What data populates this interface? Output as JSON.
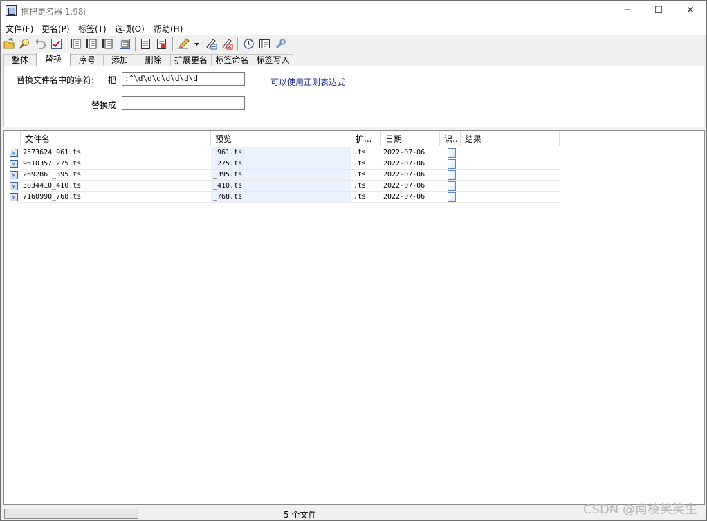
{
  "window": {
    "title": "拖把更名器 1.98i",
    "controls": {
      "minimize": "─",
      "maximize": "☐",
      "close": "✕"
    }
  },
  "menu": [
    "文件(F)",
    "更名(P)",
    "标签(T)",
    "选项(O)",
    "帮助(H)"
  ],
  "toolbar": {
    "icons": [
      "open-folder-icon",
      "search-icon",
      "undo-icon",
      "check-icon",
      "tag-1-icon",
      "tag-2-icon",
      "tag-3-icon",
      "tag-edit-icon",
      "document-icon",
      "document-export-icon",
      "pen-icon",
      "dropdown-arrow-icon",
      "rename-edit-icon",
      "rename-clear-icon",
      "clock-icon",
      "settings-panel-icon",
      "tools-icon"
    ]
  },
  "tabs": [
    "整体",
    "替换",
    "序号",
    "添加",
    "删除",
    "扩展更名",
    "标签命名",
    "标签写入"
  ],
  "active_tab": "替换",
  "replace": {
    "find_label": "替换文件名中的字符:",
    "by_label": "把",
    "find_value": ":^\\d\\d\\d\\d\\d\\d\\d",
    "replace_label": "替换成",
    "replace_value": "",
    "regex_note": "可以使用正则表达式"
  },
  "table": {
    "headers": [
      "文件名",
      "预览",
      "扩...",
      "日期",
      "识..",
      "结果"
    ],
    "rows": [
      {
        "checked": "√",
        "filename": "7573624_961.ts",
        "preview": "_961.ts",
        "ext": ".ts",
        "date": "2022-07-06",
        "result": ""
      },
      {
        "checked": "√",
        "filename": "9610357_275.ts",
        "preview": "_275.ts",
        "ext": ".ts",
        "date": "2022-07-06",
        "result": ""
      },
      {
        "checked": "√",
        "filename": "2692861_395.ts",
        "preview": "_395.ts",
        "ext": ".ts",
        "date": "2022-07-06",
        "result": ""
      },
      {
        "checked": "√",
        "filename": "3034410_410.ts",
        "preview": "_410.ts",
        "ext": ".ts",
        "date": "2022-07-06",
        "result": ""
      },
      {
        "checked": "√",
        "filename": "7160990_768.ts",
        "preview": "_768.ts",
        "ext": ".ts",
        "date": "2022-07-06",
        "result": ""
      }
    ]
  },
  "status": {
    "file_count": "5 个文件",
    "progress": 0
  },
  "watermark": "CSDN @南棱笑笑生",
  "colors": {
    "preview_bg": "#eaf2fd",
    "regex_text": "#1f2f8f",
    "check_blue": "#3463a8"
  }
}
